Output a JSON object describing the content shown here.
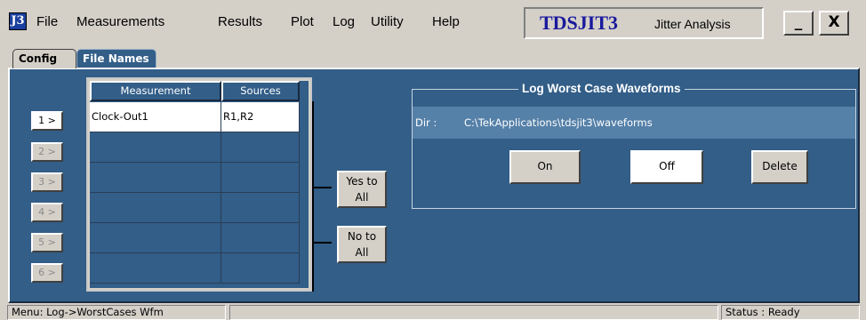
{
  "app": {
    "icon_glyph": "J3",
    "brand_title": "TDSJIT3",
    "brand_subtitle": "Jitter Analysis"
  },
  "menu": [
    "File",
    "Measurements",
    "Results",
    "Plot",
    "Log",
    "Utility",
    "Help"
  ],
  "window_buttons": {
    "minimize": "_",
    "close": "X"
  },
  "tabs": [
    {
      "label": "Config",
      "active": true
    },
    {
      "label": "File Names",
      "active": false
    }
  ],
  "row_buttons": [
    "1 >",
    "2 >",
    "3 >",
    "4 >",
    "5 >",
    "6 >"
  ],
  "grid": {
    "headers": [
      "Measurement",
      "Sources"
    ],
    "rows": [
      [
        "Clock-Out1",
        "R1,R2"
      ],
      [
        "",
        ""
      ],
      [
        "",
        ""
      ],
      [
        "",
        ""
      ],
      [
        "",
        ""
      ],
      [
        "",
        ""
      ]
    ]
  },
  "yes_to_all": {
    "line1": "Yes to",
    "line2": "All"
  },
  "no_to_all": {
    "line1": "No to",
    "line2": "All"
  },
  "log_group": {
    "title": "Log Worst Case Waveforms",
    "dir_label": "Dir :",
    "dir_value": "C:\\TekApplications\\tdsjit3\\waveforms",
    "on_label": "On",
    "off_label": "Off",
    "delete_label": "Delete",
    "selected": "Off"
  },
  "status_bar": {
    "menu_text": "Menu: Log->WorstCases Wfm",
    "status_text": "Status : Ready"
  },
  "colors": {
    "panel_blue": "#325e88",
    "dir_blue": "#5580a8",
    "window_gray": "#d4d0c8",
    "brand_blue": "#1a1a9c"
  }
}
